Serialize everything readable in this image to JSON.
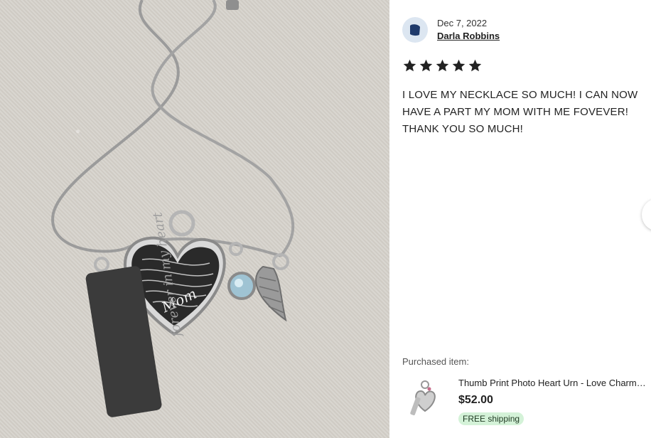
{
  "review": {
    "date": "Dec 7, 2022",
    "reviewer": "Darla Robbins",
    "rating": 5,
    "text": "I LOVE MY NECKLACE SO MUCH! I CAN NOW HAVE A PART MY MOM WITH ME FOVEVER! THANK YOU SO MUCH!"
  },
  "purchase": {
    "label": "Purchased item:",
    "title": "Thumb Print Photo Heart Urn - Love Charm Necklace",
    "price": "$52.00",
    "shipping_badge": "FREE shipping"
  },
  "photo": {
    "heart_text": "Mom",
    "bar_text": "forever in my heart"
  },
  "colors": {
    "star": "#222222",
    "shipping_badge_bg": "#d4f2d8",
    "avatar_bg": "#dce6f1",
    "avatar_icon": "#1f3a6b"
  },
  "icons": {
    "avatar": "user-avatar-icon",
    "star": "star-icon",
    "next": "chevron-right-icon"
  }
}
